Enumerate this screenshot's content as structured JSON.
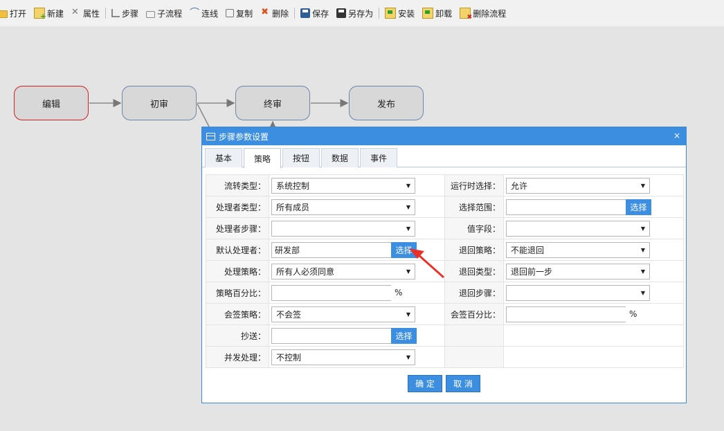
{
  "toolbar": {
    "open": "打开",
    "new": "新建",
    "properties": "属性",
    "step": "步骤",
    "subflow": "子流程",
    "connect": "连线",
    "copy": "复制",
    "delete": "删除",
    "save": "保存",
    "save_as": "另存为",
    "install": "安装",
    "uninstall": "卸载",
    "delete_flow": "删除流程"
  },
  "nodes": {
    "edit": "编辑",
    "first_review": "初审",
    "final_review": "终审",
    "publish": "发布"
  },
  "dialog": {
    "title": "步骤参数设置",
    "close": "×",
    "tabs": [
      "基本",
      "策略",
      "按钮",
      "数据",
      "事件"
    ],
    "active_tab": "策略",
    "left": {
      "flow_type_label": "流转类型：",
      "flow_type_value": "系统控制",
      "handler_type_label": "处理者类型：",
      "handler_type_value": "所有成员",
      "handler_step_label": "处理者步骤：",
      "handler_step_value": "",
      "default_handler_label": "默认处理者：",
      "default_handler_value": "研发部",
      "strategy_label": "处理策略：",
      "strategy_value": "所有人必须同意",
      "strategy_percent_label": "策略百分比：",
      "strategy_percent_value": "",
      "countersign_label": "会签策略：",
      "countersign_value": "不会签",
      "cc_label": "抄送：",
      "cc_value": "",
      "concurrent_label": "并发处理：",
      "concurrent_value": "不控制"
    },
    "right": {
      "runtime_select_label": "运行时选择：",
      "runtime_select_value": "允许",
      "select_range_label": "选择范围：",
      "select_range_value": "",
      "value_field_label": "值字段：",
      "value_field_value": "",
      "return_strategy_label": "退回策略：",
      "return_strategy_value": "不能退回",
      "return_type_label": "退回类型：",
      "return_type_value": "退回前一步",
      "return_step_label": "退回步骤：",
      "return_step_value": "",
      "countersign_percent_label": "会签百分比：",
      "countersign_percent_value": ""
    },
    "percent_sign": "%",
    "pick_label": "选择",
    "confirm": "确 定",
    "cancel": "取 消"
  },
  "colors": {
    "accent": "#3c8ee0",
    "active_node_border": "#cc2222",
    "node_border": "#6b87a8",
    "annotation_arrow": "#e8312a"
  }
}
